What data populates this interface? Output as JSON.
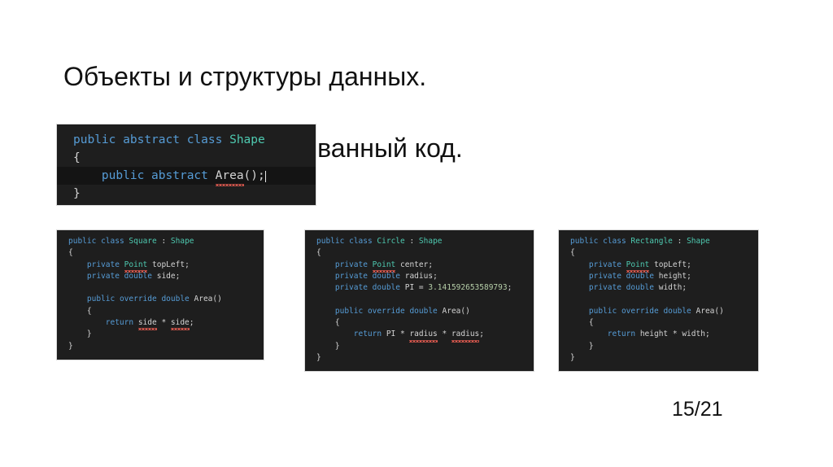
{
  "slide": {
    "title_line_1": "Объекты и структуры данных.",
    "title_line_2": "Объектно-ориентированный код.",
    "page_number": "15/21",
    "background_color": "#ffffff",
    "text_color": "#111111"
  },
  "theme": {
    "editor_background": "#1e1e1e",
    "editor_current_line_background": "#141414",
    "editor_border": "#d9d9d9",
    "keyword_color": "#569cd6",
    "type_color": "#4ec9b0",
    "identifier_color": "#d4d4d4",
    "number_color": "#b5cea8",
    "error_squiggle_color": "#e05a4f",
    "caret_color": "#e8e8e8"
  },
  "code_blocks": [
    {
      "id": "shape",
      "name": "Shape abstract class editor",
      "language": "csharp",
      "lines": [
        {
          "current": false,
          "text": "public abstract class Shape",
          "tokens": [
            {
              "t": "public",
              "c": "kw"
            },
            {
              "t": " ",
              "c": "punc"
            },
            {
              "t": "abstract",
              "c": "kw"
            },
            {
              "t": " ",
              "c": "punc"
            },
            {
              "t": "class",
              "c": "kw"
            },
            {
              "t": " ",
              "c": "punc"
            },
            {
              "t": "Shape",
              "c": "type"
            }
          ]
        },
        {
          "current": false,
          "text": "{",
          "tokens": [
            {
              "t": "{",
              "c": "punc"
            }
          ]
        },
        {
          "current": true,
          "caret": true,
          "text": "    public abstract Area();",
          "tokens": [
            {
              "t": "    ",
              "c": "punc"
            },
            {
              "t": "public",
              "c": "kw"
            },
            {
              "t": " ",
              "c": "punc"
            },
            {
              "t": "abstract",
              "c": "kw"
            },
            {
              "t": " ",
              "c": "punc"
            },
            {
              "t": "Area",
              "c": "id",
              "squiggle": true
            },
            {
              "t": "();",
              "c": "punc"
            }
          ]
        },
        {
          "current": false,
          "text": "}",
          "tokens": [
            {
              "t": "}",
              "c": "punc"
            }
          ]
        }
      ]
    },
    {
      "id": "square",
      "name": "Square class snippet",
      "language": "csharp",
      "lines": [
        {
          "current": false,
          "text": "public class Square : Shape",
          "tokens": [
            {
              "t": "public",
              "c": "kw"
            },
            {
              "t": " ",
              "c": "punc"
            },
            {
              "t": "class",
              "c": "kw"
            },
            {
              "t": " ",
              "c": "punc"
            },
            {
              "t": "Square",
              "c": "type"
            },
            {
              "t": " : ",
              "c": "punc"
            },
            {
              "t": "Shape",
              "c": "type"
            }
          ]
        },
        {
          "current": false,
          "text": "{",
          "tokens": [
            {
              "t": "{",
              "c": "punc"
            }
          ]
        },
        {
          "current": false,
          "text": "    private Point topLeft;",
          "tokens": [
            {
              "t": "    ",
              "c": "punc"
            },
            {
              "t": "private",
              "c": "kw"
            },
            {
              "t": " ",
              "c": "punc"
            },
            {
              "t": "Point",
              "c": "type",
              "squiggle": true
            },
            {
              "t": " ",
              "c": "punc"
            },
            {
              "t": "topLeft",
              "c": "id"
            },
            {
              "t": ";",
              "c": "punc"
            }
          ]
        },
        {
          "current": false,
          "text": "    private double side;",
          "tokens": [
            {
              "t": "    ",
              "c": "punc"
            },
            {
              "t": "private",
              "c": "kw"
            },
            {
              "t": " ",
              "c": "punc"
            },
            {
              "t": "double",
              "c": "kw"
            },
            {
              "t": " ",
              "c": "punc"
            },
            {
              "t": "side",
              "c": "id"
            },
            {
              "t": ";",
              "c": "punc"
            }
          ]
        },
        {
          "current": false,
          "text": "",
          "tokens": [
            {
              "t": " ",
              "c": "punc"
            }
          ]
        },
        {
          "current": false,
          "text": "    public override double Area()",
          "tokens": [
            {
              "t": "    ",
              "c": "punc"
            },
            {
              "t": "public",
              "c": "kw"
            },
            {
              "t": " ",
              "c": "punc"
            },
            {
              "t": "override",
              "c": "kw"
            },
            {
              "t": " ",
              "c": "punc"
            },
            {
              "t": "double",
              "c": "kw"
            },
            {
              "t": " ",
              "c": "punc"
            },
            {
              "t": "Area",
              "c": "id"
            },
            {
              "t": "()",
              "c": "punc"
            }
          ]
        },
        {
          "current": false,
          "text": "    {",
          "tokens": [
            {
              "t": "    {",
              "c": "punc"
            }
          ]
        },
        {
          "current": false,
          "text": "        return side * side;",
          "tokens": [
            {
              "t": "        ",
              "c": "punc"
            },
            {
              "t": "return",
              "c": "kw"
            },
            {
              "t": " ",
              "c": "punc"
            },
            {
              "t": "side",
              "c": "id",
              "squiggle": true
            },
            {
              "t": " * ",
              "c": "op"
            },
            {
              "t": "side",
              "c": "id",
              "squiggle": true
            },
            {
              "t": ";",
              "c": "punc"
            }
          ]
        },
        {
          "current": false,
          "text": "    }",
          "tokens": [
            {
              "t": "    }",
              "c": "punc"
            }
          ]
        },
        {
          "current": false,
          "text": "}",
          "tokens": [
            {
              "t": "}",
              "c": "punc"
            }
          ]
        }
      ]
    },
    {
      "id": "circle",
      "name": "Circle class snippet",
      "language": "csharp",
      "lines": [
        {
          "current": false,
          "text": "public class Circle : Shape",
          "tokens": [
            {
              "t": "public",
              "c": "kw"
            },
            {
              "t": " ",
              "c": "punc"
            },
            {
              "t": "class",
              "c": "kw"
            },
            {
              "t": " ",
              "c": "punc"
            },
            {
              "t": "Circle",
              "c": "type"
            },
            {
              "t": " : ",
              "c": "punc"
            },
            {
              "t": "Shape",
              "c": "type"
            }
          ]
        },
        {
          "current": false,
          "text": "{",
          "tokens": [
            {
              "t": "{",
              "c": "punc"
            }
          ]
        },
        {
          "current": false,
          "text": "    private Point center;",
          "tokens": [
            {
              "t": "    ",
              "c": "punc"
            },
            {
              "t": "private",
              "c": "kw"
            },
            {
              "t": " ",
              "c": "punc"
            },
            {
              "t": "Point",
              "c": "type",
              "squiggle": true
            },
            {
              "t": " ",
              "c": "punc"
            },
            {
              "t": "center",
              "c": "id"
            },
            {
              "t": ";",
              "c": "punc"
            }
          ]
        },
        {
          "current": false,
          "text": "    private double radius;",
          "tokens": [
            {
              "t": "    ",
              "c": "punc"
            },
            {
              "t": "private",
              "c": "kw"
            },
            {
              "t": " ",
              "c": "punc"
            },
            {
              "t": "double",
              "c": "kw"
            },
            {
              "t": " ",
              "c": "punc"
            },
            {
              "t": "radius",
              "c": "id"
            },
            {
              "t": ";",
              "c": "punc"
            }
          ]
        },
        {
          "current": false,
          "text": "    private double PI = 3.141592653589793;",
          "tokens": [
            {
              "t": "    ",
              "c": "punc"
            },
            {
              "t": "private",
              "c": "kw"
            },
            {
              "t": " ",
              "c": "punc"
            },
            {
              "t": "double",
              "c": "kw"
            },
            {
              "t": " ",
              "c": "punc"
            },
            {
              "t": "PI",
              "c": "id"
            },
            {
              "t": " = ",
              "c": "op"
            },
            {
              "t": "3.141592653589793",
              "c": "num"
            },
            {
              "t": ";",
              "c": "punc"
            }
          ]
        },
        {
          "current": false,
          "text": "",
          "tokens": [
            {
              "t": " ",
              "c": "punc"
            }
          ]
        },
        {
          "current": false,
          "text": "    public override double Area()",
          "tokens": [
            {
              "t": "    ",
              "c": "punc"
            },
            {
              "t": "public",
              "c": "kw"
            },
            {
              "t": " ",
              "c": "punc"
            },
            {
              "t": "override",
              "c": "kw"
            },
            {
              "t": " ",
              "c": "punc"
            },
            {
              "t": "double",
              "c": "kw"
            },
            {
              "t": " ",
              "c": "punc"
            },
            {
              "t": "Area",
              "c": "id"
            },
            {
              "t": "()",
              "c": "punc"
            }
          ]
        },
        {
          "current": false,
          "text": "    {",
          "tokens": [
            {
              "t": "    {",
              "c": "punc"
            }
          ]
        },
        {
          "current": false,
          "text": "        return PI * radius * radius;",
          "tokens": [
            {
              "t": "        ",
              "c": "punc"
            },
            {
              "t": "return",
              "c": "kw"
            },
            {
              "t": " ",
              "c": "punc"
            },
            {
              "t": "PI",
              "c": "id"
            },
            {
              "t": " * ",
              "c": "op"
            },
            {
              "t": "radius",
              "c": "id",
              "squiggle": true
            },
            {
              "t": " * ",
              "c": "op"
            },
            {
              "t": "radius",
              "c": "id",
              "squiggle": true
            },
            {
              "t": ";",
              "c": "punc"
            }
          ]
        },
        {
          "current": false,
          "text": "    }",
          "tokens": [
            {
              "t": "    }",
              "c": "punc"
            }
          ]
        },
        {
          "current": false,
          "text": "}",
          "tokens": [
            {
              "t": "}",
              "c": "punc"
            }
          ]
        }
      ]
    },
    {
      "id": "rectangle",
      "name": "Rectangle class snippet",
      "language": "csharp",
      "lines": [
        {
          "current": false,
          "text": "public class Rectangle : Shape",
          "tokens": [
            {
              "t": "public",
              "c": "kw"
            },
            {
              "t": " ",
              "c": "punc"
            },
            {
              "t": "class",
              "c": "kw"
            },
            {
              "t": " ",
              "c": "punc"
            },
            {
              "t": "Rectangle",
              "c": "type"
            },
            {
              "t": " : ",
              "c": "punc"
            },
            {
              "t": "Shape",
              "c": "type"
            }
          ]
        },
        {
          "current": false,
          "text": "{",
          "tokens": [
            {
              "t": "{",
              "c": "punc"
            }
          ]
        },
        {
          "current": false,
          "text": "    private Point topLeft;",
          "tokens": [
            {
              "t": "    ",
              "c": "punc"
            },
            {
              "t": "private",
              "c": "kw"
            },
            {
              "t": " ",
              "c": "punc"
            },
            {
              "t": "Point",
              "c": "type",
              "squiggle": true
            },
            {
              "t": " ",
              "c": "punc"
            },
            {
              "t": "topLeft",
              "c": "id"
            },
            {
              "t": ";",
              "c": "punc"
            }
          ]
        },
        {
          "current": false,
          "text": "    private double height;",
          "tokens": [
            {
              "t": "    ",
              "c": "punc"
            },
            {
              "t": "private",
              "c": "kw"
            },
            {
              "t": " ",
              "c": "punc"
            },
            {
              "t": "double",
              "c": "kw"
            },
            {
              "t": " ",
              "c": "punc"
            },
            {
              "t": "height",
              "c": "id"
            },
            {
              "t": ";",
              "c": "punc"
            }
          ]
        },
        {
          "current": false,
          "text": "    private double width;",
          "tokens": [
            {
              "t": "    ",
              "c": "punc"
            },
            {
              "t": "private",
              "c": "kw"
            },
            {
              "t": " ",
              "c": "punc"
            },
            {
              "t": "double",
              "c": "kw"
            },
            {
              "t": " ",
              "c": "punc"
            },
            {
              "t": "width",
              "c": "id"
            },
            {
              "t": ";",
              "c": "punc"
            }
          ]
        },
        {
          "current": false,
          "text": "",
          "tokens": [
            {
              "t": " ",
              "c": "punc"
            }
          ]
        },
        {
          "current": false,
          "text": "    public override double Area()",
          "tokens": [
            {
              "t": "    ",
              "c": "punc"
            },
            {
              "t": "public",
              "c": "kw"
            },
            {
              "t": " ",
              "c": "punc"
            },
            {
              "t": "override",
              "c": "kw"
            },
            {
              "t": " ",
              "c": "punc"
            },
            {
              "t": "double",
              "c": "kw"
            },
            {
              "t": " ",
              "c": "punc"
            },
            {
              "t": "Area",
              "c": "id"
            },
            {
              "t": "()",
              "c": "punc"
            }
          ]
        },
        {
          "current": false,
          "text": "    {",
          "tokens": [
            {
              "t": "    {",
              "c": "punc"
            }
          ]
        },
        {
          "current": false,
          "text": "        return height * width;",
          "tokens": [
            {
              "t": "        ",
              "c": "punc"
            },
            {
              "t": "return",
              "c": "kw"
            },
            {
              "t": " ",
              "c": "punc"
            },
            {
              "t": "height",
              "c": "id"
            },
            {
              "t": " * ",
              "c": "op"
            },
            {
              "t": "width",
              "c": "id"
            },
            {
              "t": ";",
              "c": "punc"
            }
          ]
        },
        {
          "current": false,
          "text": "    }",
          "tokens": [
            {
              "t": "    }",
              "c": "punc"
            }
          ]
        },
        {
          "current": false,
          "text": "}",
          "tokens": [
            {
              "t": "}",
              "c": "punc"
            }
          ]
        }
      ]
    }
  ]
}
